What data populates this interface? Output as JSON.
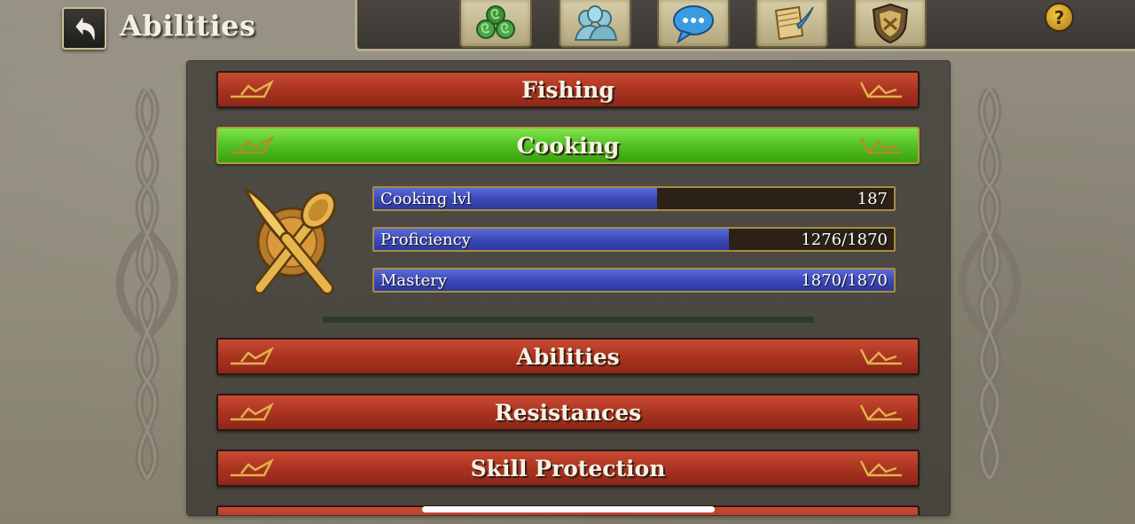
{
  "header": {
    "title": "Abilities",
    "back_icon": "back-arrow-icon",
    "nav_icons": [
      "spiral-rune-icon",
      "group-icon",
      "chat-bubble-icon",
      "scroll-quill-icon",
      "crest-shield-icon"
    ],
    "help_label": "?"
  },
  "sections": {
    "fishing": "Fishing",
    "cooking": "Cooking",
    "abilities": "Abilities",
    "resistances": "Resistances",
    "skill_protection": "Skill Protection"
  },
  "cooking_stats": [
    {
      "label": "Cooking lvl",
      "value": "187",
      "fill": 0.545
    },
    {
      "label": "Proficiency",
      "value": "1276/1870",
      "fill": 0.6823
    },
    {
      "label": "Mastery",
      "value": "1870/1870",
      "fill": 1.0
    }
  ],
  "colors": {
    "section_red": "#a8321f",
    "section_active_green": "#4fbe1f",
    "stat_fill_blue": "#3a47b5",
    "stat_track": "#2b2116",
    "gold_trim": "#a68c45"
  },
  "cooking_icon": "crossed-knife-spoon-icon"
}
